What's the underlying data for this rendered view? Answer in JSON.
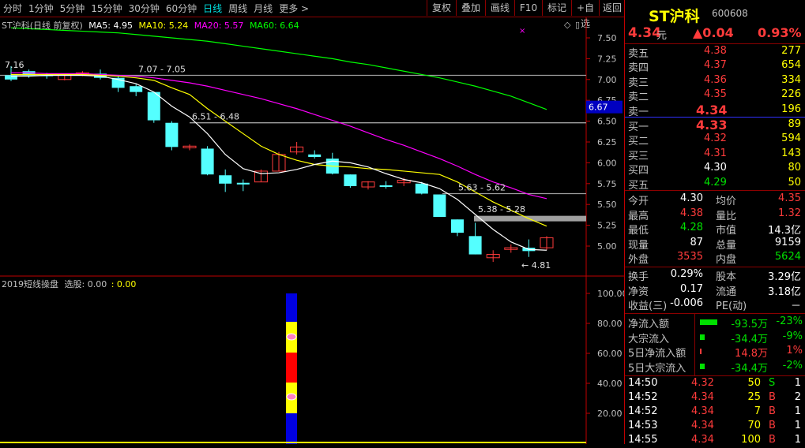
{
  "toolbar": {
    "periods": [
      "分时",
      "1分钟",
      "5分钟",
      "15分钟",
      "30分钟",
      "60分钟",
      "日线",
      "周线",
      "月线",
      "更多 >"
    ],
    "active_period": "日线",
    "buttons": [
      "复权",
      "叠加",
      "画线",
      "F10",
      "标记",
      "+自选",
      "返回"
    ]
  },
  "main_chart": {
    "info_title": "ST沪科(日线 前复权)",
    "ma5_label": "MA5: 4.95",
    "ma10_label": "MA10: 5.24",
    "ma20_label": "MA20: 5.57",
    "ma60_label": "MA60: 6.64",
    "colors": {
      "ma5": "#ffffff",
      "ma10": "#ffff00",
      "ma20": "#ff00ff",
      "ma60": "#00ff00",
      "up": "#ff3b3b",
      "down": "#54ffff"
    },
    "y_ticks": [
      "7.50",
      "7.25",
      "7.00",
      "6.75",
      "6.50",
      "6.25",
      "6.00",
      "5.75",
      "5.50",
      "5.25",
      "5.00"
    ],
    "price_tag": "6.67",
    "annotations": [
      "7.07 - 7.05",
      "6.51 - 6.48",
      "5.63 - 5.62",
      "5.38 - 5.28",
      "← 4.81",
      "7.16"
    ]
  },
  "chart_data": {
    "type": "candlestick",
    "ylim": [
      4.75,
      7.6
    ],
    "candles": [
      {
        "o": 7.05,
        "h": 7.16,
        "l": 6.98,
        "c": 7.0
      },
      {
        "o": 7.1,
        "h": 7.12,
        "l": 7.02,
        "c": 7.05
      },
      {
        "o": 7.06,
        "h": 7.08,
        "l": 7.01,
        "c": 7.04
      },
      {
        "o": 7.0,
        "h": 7.06,
        "l": 6.99,
        "c": 7.06
      },
      {
        "o": 7.07,
        "h": 7.1,
        "l": 7.04,
        "c": 7.08
      },
      {
        "o": 7.07,
        "h": 7.12,
        "l": 7.0,
        "c": 7.02
      },
      {
        "o": 7.02,
        "h": 7.04,
        "l": 6.85,
        "c": 6.9
      },
      {
        "o": 6.92,
        "h": 6.95,
        "l": 6.8,
        "c": 6.85
      },
      {
        "o": 6.85,
        "h": 6.85,
        "l": 6.48,
        "c": 6.51
      },
      {
        "o": 6.48,
        "h": 6.5,
        "l": 6.15,
        "c": 6.19
      },
      {
        "o": 6.18,
        "h": 6.22,
        "l": 6.15,
        "c": 6.2
      },
      {
        "o": 6.17,
        "h": 6.2,
        "l": 5.85,
        "c": 5.86
      },
      {
        "o": 5.85,
        "h": 5.92,
        "l": 5.65,
        "c": 5.75
      },
      {
        "o": 5.76,
        "h": 5.8,
        "l": 5.66,
        "c": 5.74
      },
      {
        "o": 5.77,
        "h": 5.92,
        "l": 5.77,
        "c": 5.9
      },
      {
        "o": 5.9,
        "h": 6.13,
        "l": 5.9,
        "c": 6.1
      },
      {
        "o": 6.13,
        "h": 6.25,
        "l": 6.1,
        "c": 6.19
      },
      {
        "o": 6.1,
        "h": 6.15,
        "l": 6.05,
        "c": 6.07
      },
      {
        "o": 6.05,
        "h": 6.12,
        "l": 5.86,
        "c": 5.87
      },
      {
        "o": 5.86,
        "h": 5.86,
        "l": 5.7,
        "c": 5.72
      },
      {
        "o": 5.71,
        "h": 5.78,
        "l": 5.68,
        "c": 5.77
      },
      {
        "o": 5.73,
        "h": 5.78,
        "l": 5.69,
        "c": 5.71
      },
      {
        "o": 5.76,
        "h": 5.82,
        "l": 5.72,
        "c": 5.79
      },
      {
        "o": 5.75,
        "h": 5.77,
        "l": 5.62,
        "c": 5.63
      },
      {
        "o": 5.62,
        "h": 5.62,
        "l": 5.35,
        "c": 5.35
      },
      {
        "o": 5.32,
        "h": 5.32,
        "l": 5.12,
        "c": 5.16
      },
      {
        "o": 5.12,
        "h": 5.28,
        "l": 4.9,
        "c": 4.9
      },
      {
        "o": 4.86,
        "h": 4.95,
        "l": 4.81,
        "c": 4.9
      },
      {
        "o": 4.96,
        "h": 5.02,
        "l": 4.92,
        "c": 4.98
      },
      {
        "o": 4.98,
        "h": 5.08,
        "l": 4.87,
        "c": 4.94
      },
      {
        "o": 4.98,
        "h": 5.12,
        "l": 4.95,
        "c": 5.1
      }
    ],
    "ma5": [
      7.04,
      7.04,
      7.05,
      7.05,
      7.05,
      7.04,
      7.0,
      6.95,
      6.85,
      6.68,
      6.55,
      6.35,
      6.1,
      5.93,
      5.87,
      5.88,
      5.92,
      5.98,
      6.02,
      6.0,
      5.95,
      5.87,
      5.8,
      5.76,
      5.69,
      5.56,
      5.38,
      5.2,
      5.05,
      4.96,
      4.95
    ],
    "ma10": [
      7.06,
      7.06,
      7.06,
      7.06,
      7.06,
      7.05,
      7.04,
      7.02,
      6.99,
      6.9,
      6.82,
      6.65,
      6.5,
      6.35,
      6.2,
      6.1,
      6.03,
      5.98,
      5.96,
      5.95,
      5.93,
      5.92,
      5.9,
      5.88,
      5.86,
      5.77,
      5.65,
      5.53,
      5.43,
      5.33,
      5.24
    ],
    "ma20": [
      7.08,
      7.08,
      7.07,
      7.07,
      7.07,
      7.06,
      7.05,
      7.04,
      7.02,
      6.99,
      6.96,
      6.92,
      6.87,
      6.82,
      6.77,
      6.71,
      6.65,
      6.58,
      6.51,
      6.44,
      6.36,
      6.28,
      6.21,
      6.13,
      6.05,
      5.96,
      5.86,
      5.77,
      5.7,
      5.62,
      5.57
    ],
    "ma60": [
      7.62,
      7.61,
      7.6,
      7.59,
      7.58,
      7.57,
      7.56,
      7.54,
      7.52,
      7.5,
      7.48,
      7.46,
      7.43,
      7.4,
      7.37,
      7.34,
      7.31,
      7.28,
      7.25,
      7.21,
      7.18,
      7.14,
      7.1,
      7.06,
      7.02,
      6.97,
      6.92,
      6.86,
      6.8,
      6.72,
      6.64
    ],
    "hlines": [
      7.05,
      6.48,
      5.63,
      5.33
    ]
  },
  "sub_chart": {
    "title": "2019短线操盘",
    "select_label": "选股: 0.00",
    "value_label": ": 0.00",
    "y_ticks": [
      "100.00",
      "80.00",
      "60.00",
      "40.00",
      "20.00"
    ]
  },
  "quote": {
    "name": "ST沪科",
    "code": "600608",
    "price": "4.34",
    "price_unit": "元",
    "change": "▲0.04",
    "change_pct": "0.93%",
    "asks": [
      {
        "label": "卖五",
        "price": "4.38",
        "vol": "277"
      },
      {
        "label": "卖四",
        "price": "4.37",
        "vol": "654"
      },
      {
        "label": "卖三",
        "price": "4.36",
        "vol": "334"
      },
      {
        "label": "卖二",
        "price": "4.35",
        "vol": "226"
      },
      {
        "label": "卖一",
        "price": "4.34",
        "vol": "196"
      }
    ],
    "bids": [
      {
        "label": "买一",
        "price": "4.33",
        "vol": "89"
      },
      {
        "label": "买二",
        "price": "4.32",
        "vol": "594"
      },
      {
        "label": "买三",
        "price": "4.31",
        "vol": "143"
      },
      {
        "label": "买四",
        "price": "4.30",
        "vol": "80"
      },
      {
        "label": "买五",
        "price": "4.29",
        "vol": "50"
      }
    ],
    "stats": [
      {
        "l1": "今开",
        "v1": "4.30",
        "l2": "均价",
        "v2": "4.35"
      },
      {
        "l1": "最高",
        "v1": "4.38",
        "l2": "量比",
        "v2": "1.32"
      },
      {
        "l1": "最低",
        "v1": "4.28",
        "l2": "市值",
        "v2": "14.3亿"
      },
      {
        "l1": "现量",
        "v1": "87",
        "l2": "总量",
        "v2": "9159"
      },
      {
        "l1": "外盘",
        "v1": "3535",
        "l2": "内盘",
        "v2": "5624"
      }
    ],
    "fin": [
      {
        "l1": "换手",
        "v1": "0.29%",
        "l2": "股本",
        "v2": "3.29亿"
      },
      {
        "l1": "净资",
        "v1": "0.17",
        "l2": "流通",
        "v2": "3.18亿"
      },
      {
        "l1": "收益(三)",
        "v1": "-0.006",
        "l2": "PE(动)",
        "v2": "－"
      }
    ],
    "flows": [
      {
        "label": "净流入额",
        "value": "-93.5万",
        "pct": "-23%"
      },
      {
        "label": "大宗流入",
        "value": "-34.4万",
        "pct": "-9%"
      },
      {
        "label": "5日净流入额",
        "value": "14.8万",
        "pct": "1%"
      },
      {
        "label": "5日大宗流入",
        "value": "-34.4万",
        "pct": "-2%"
      }
    ],
    "ticks": [
      {
        "time": "14:50",
        "price": "4.32",
        "vol": "50",
        "side": "S",
        "n": "1"
      },
      {
        "time": "14:52",
        "price": "4.34",
        "vol": "25",
        "side": "B",
        "n": "2"
      },
      {
        "time": "14:52",
        "price": "4.34",
        "vol": "7",
        "side": "B",
        "n": "1"
      },
      {
        "time": "14:53",
        "price": "4.34",
        "vol": "70",
        "side": "B",
        "n": "1"
      },
      {
        "time": "14:55",
        "price": "4.34",
        "vol": "100",
        "side": "B",
        "n": "1"
      }
    ]
  }
}
